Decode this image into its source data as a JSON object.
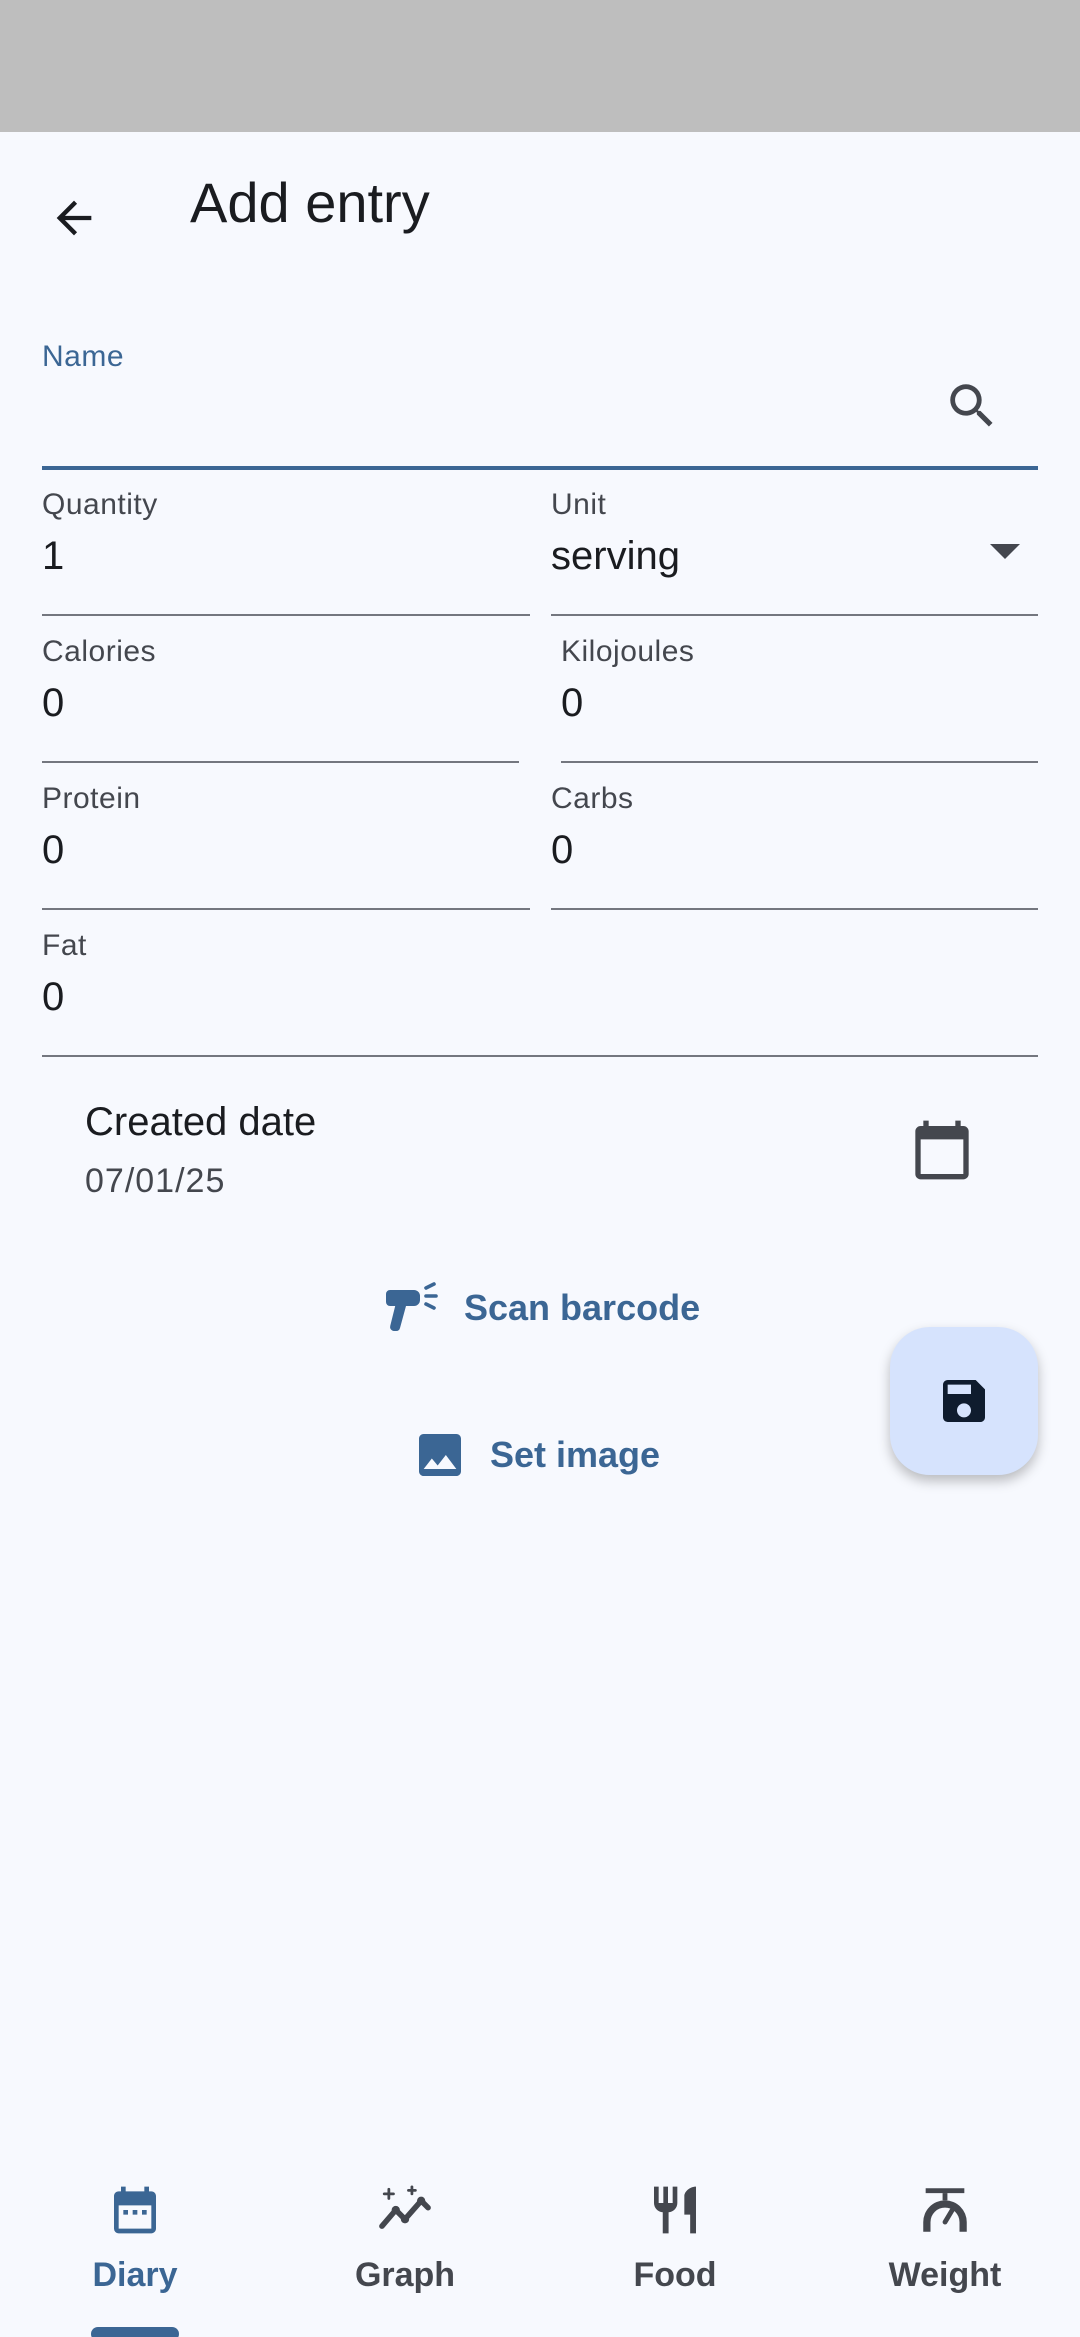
{
  "app_bar": {
    "title": "Add entry"
  },
  "form": {
    "name": {
      "label": "Name",
      "value": ""
    },
    "quantity": {
      "label": "Quantity",
      "value": "1"
    },
    "unit": {
      "label": "Unit",
      "value": "serving"
    },
    "calories": {
      "label": "Calories",
      "value": "0"
    },
    "kilojoules": {
      "label": "Kilojoules",
      "value": "0"
    },
    "protein": {
      "label": "Protein",
      "value": "0"
    },
    "carbs": {
      "label": "Carbs",
      "value": "0"
    },
    "fat": {
      "label": "Fat",
      "value": "0"
    },
    "created_date": {
      "label": "Created date",
      "value": "07/01/25"
    }
  },
  "actions": {
    "scan_barcode": "Scan barcode",
    "set_image": "Set image"
  },
  "bottom_nav": {
    "items": [
      {
        "label": "Diary",
        "icon": "calendar-icon",
        "active": true
      },
      {
        "label": "Graph",
        "icon": "graph-icon",
        "active": false
      },
      {
        "label": "Food",
        "icon": "utensils-icon",
        "active": false
      },
      {
        "label": "Weight",
        "icon": "scale-icon",
        "active": false
      }
    ]
  },
  "colors": {
    "accent": "#3b6694",
    "background": "#f7f9fe",
    "fab": "#d6e3fd",
    "status_bar": "#bebebe"
  }
}
